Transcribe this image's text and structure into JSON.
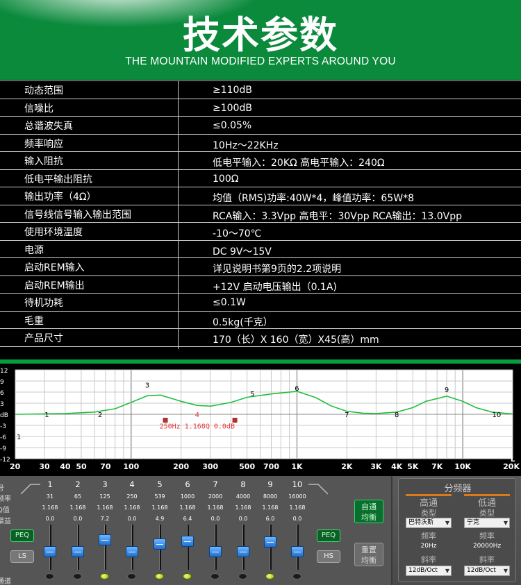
{
  "header": {
    "title": "技术参数",
    "subtitle": "THE MOUNTAIN MODIFIED EXPERTS AROUND YOU"
  },
  "specs": [
    {
      "key": "动态范围",
      "value": "≥110dB"
    },
    {
      "key": "信噪比",
      "value": "≥100dB"
    },
    {
      "key": "总谐波失真",
      "value": "≤0.05%"
    },
    {
      "key": "频率响应",
      "value": "10Hz～22KHz"
    },
    {
      "key": "输入阻抗",
      "value": "低电平输入：20KΩ 高电平输入：240Ω"
    },
    {
      "key": "低电平输出阻抗",
      "value": "100Ω"
    },
    {
      "key": "输出功率（4Ω）",
      "value": "均值（RMS)功率:40W*4，峰值功率：65W*8"
    },
    {
      "key": "信号线信号输入输出范围",
      "value": "RCA输入：3.3Vpp 高电平：30Vpp RCA输出：13.0Vpp"
    },
    {
      "key": "使用环境温度",
      "value": "-10～70℃"
    },
    {
      "key": "电源",
      "value": "DC 9V～15V"
    },
    {
      "key": "启动REM输入",
      "value": "详见说明书第9页的2.2项说明"
    },
    {
      "key": "启动REM输出",
      "value": "+12V 启动电压输出（0.1A)"
    },
    {
      "key": "待机功耗",
      "value": "≤0.1W"
    },
    {
      "key": "毛重",
      "value": "0.5kg(千克）"
    },
    {
      "key": "产品尺寸",
      "value": "170（长）X 160（宽）X45(高）mm"
    }
  ],
  "chart_data": {
    "type": "line",
    "x_scale": "log",
    "xlim": [
      20,
      20000
    ],
    "ylim": [
      -12,
      12
    ],
    "y_tick_labels": [
      "12",
      "9",
      "6",
      "3",
      "dB",
      "-3",
      "-6",
      "-9",
      "-12"
    ],
    "x_tick_labels": [
      "20",
      "30",
      "40",
      "50",
      "70",
      "100",
      "200",
      "300",
      "500",
      "700",
      "1K",
      "2K",
      "3K",
      "4K",
      "5K",
      "7K",
      "10K",
      "20K"
    ],
    "x_axis_letter": "L",
    "grid": true,
    "curve_color": "#1fbf3a",
    "series": [
      {
        "x": [
          20,
          40,
          60,
          80,
          100,
          125,
          150,
          200,
          250,
          300,
          400,
          500,
          700,
          1000,
          1300,
          1600,
          2000,
          2500,
          3000,
          4000,
          5000,
          6000,
          8000,
          10000,
          12000,
          15000,
          20000
        ],
        "y": [
          0,
          0.2,
          0.6,
          1.5,
          3.2,
          5.0,
          5.2,
          3.5,
          2.4,
          2.2,
          3.2,
          4.6,
          5.5,
          6.2,
          4.5,
          2.3,
          0.8,
          0.3,
          0.2,
          0.6,
          1.8,
          3.5,
          4.9,
          3.5,
          1.8,
          0.6,
          0.1
        ]
      }
    ],
    "band_markers": [
      {
        "label": "1",
        "freq": 31,
        "gain": 0
      },
      {
        "label": "2",
        "freq": 65,
        "gain": 0
      },
      {
        "label": "3",
        "freq": 125,
        "gain": 7.2
      },
      {
        "label": "4",
        "freq": 250,
        "gain": 0
      },
      {
        "label": "5",
        "freq": 539,
        "gain": 4.9
      },
      {
        "label": "6",
        "freq": 1000,
        "gain": 6.4
      },
      {
        "label": "7",
        "freq": 2000,
        "gain": 0
      },
      {
        "label": "8",
        "freq": 4000,
        "gain": 0
      },
      {
        "label": "9",
        "freq": 8000,
        "gain": 6.0
      },
      {
        "label": "10",
        "freq": 16000,
        "gain": 0
      }
    ],
    "selection_markers": [
      {
        "freq": 160
      },
      {
        "freq": 420
      }
    ],
    "left_marker": "1",
    "annotation": "250Hz 1.168Q 0.0dB",
    "annotation_color": "#e23b3b"
  },
  "eq": {
    "row_labels": [
      "号",
      "频率",
      "Q值",
      "增益",
      "通道"
    ],
    "bands": [
      {
        "num": "1",
        "freq": "31",
        "q": "1.168",
        "gain": "0.0",
        "level": 0.3,
        "led": false
      },
      {
        "num": "2",
        "freq": "65",
        "q": "1.168",
        "gain": "0.0",
        "level": 0.3,
        "led": false
      },
      {
        "num": "3",
        "freq": "125",
        "q": "1.168",
        "gain": "7.2",
        "level": 0.6,
        "led": true
      },
      {
        "num": "4",
        "freq": "250",
        "q": "1.168",
        "gain": "0.0",
        "level": 0.3,
        "led": false
      },
      {
        "num": "5",
        "freq": "539",
        "q": "1.168",
        "gain": "4.9",
        "level": 0.5,
        "led": true
      },
      {
        "num": "6",
        "freq": "1000",
        "q": "1.168",
        "gain": "6.4",
        "level": 0.56,
        "led": true
      },
      {
        "num": "7",
        "freq": "2000",
        "q": "1.168",
        "gain": "0.0",
        "level": 0.3,
        "led": false
      },
      {
        "num": "8",
        "freq": "4000",
        "q": "1.168",
        "gain": "0.0",
        "level": 0.3,
        "led": false
      },
      {
        "num": "9",
        "freq": "8000",
        "q": "1.168",
        "gain": "6.0",
        "level": 0.55,
        "led": true
      },
      {
        "num": "10",
        "freq": "16000",
        "q": "1.168",
        "gain": "0.0",
        "level": 0.3,
        "led": false
      }
    ],
    "peq_left": "PEQ",
    "ls_label": "LS",
    "peq_right": "PEQ",
    "hs_label": "HS",
    "auto_eq": "自通\n均衡",
    "reset_eq": "重置\n均衡"
  },
  "crossover": {
    "title": "分频器",
    "high": {
      "title": "高通",
      "type_label": "类型",
      "type_value": "巴特沃斯",
      "freq_label": "频率",
      "freq_value": "20Hz",
      "slope_label": "斜率",
      "slope_value": "12dB/Oct"
    },
    "low": {
      "title": "低通",
      "type_label": "类型",
      "type_value": "宁克",
      "freq_label": "频率",
      "freq_value": "20000Hz",
      "slope_label": "斜率",
      "slope_value": "12dB/Oct"
    }
  }
}
